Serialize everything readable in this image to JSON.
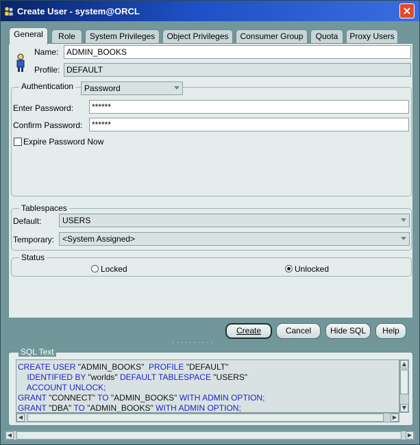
{
  "window": {
    "title": "Create User - system@ORCL",
    "close_label": "×"
  },
  "tabs": [
    {
      "label": "General"
    },
    {
      "label": "Role"
    },
    {
      "label": "System Privileges"
    },
    {
      "label": "Object Privileges"
    },
    {
      "label": "Consumer Group"
    },
    {
      "label": "Quota"
    },
    {
      "label": "Proxy Users"
    }
  ],
  "general": {
    "name_label": "Name:",
    "name_value": "ADMIN_BOOKS",
    "profile_label": "Profile:",
    "profile_value": "DEFAULT",
    "auth_label": "Authentication",
    "auth_value": "Password",
    "enter_password_label": "Enter Password:",
    "enter_password_value": "******",
    "confirm_password_label": "Confirm Password:",
    "confirm_password_value": "******",
    "expire_label": "Expire Password Now",
    "tablespaces_label": "Tablespaces",
    "default_label": "Default:",
    "default_value": "USERS",
    "temporary_label": "Temporary:",
    "temporary_value": "<System Assigned>",
    "status_label": "Status",
    "locked_label": "Locked",
    "unlocked_label": "Unlocked"
  },
  "buttons": {
    "create": "Create",
    "cancel": "Cancel",
    "hide_sql": "Hide SQL",
    "help": "Help"
  },
  "sql": {
    "label": "SQL Text",
    "lines": [
      {
        "parts": [
          [
            "kw",
            "CREATE USER "
          ],
          [
            "str",
            "\"ADMIN_BOOKS\""
          ],
          [
            "kw",
            "  PROFILE "
          ],
          [
            "str",
            "\"DEFAULT\""
          ]
        ]
      },
      {
        "parts": [
          [
            "kw",
            "    IDENTIFIED BY "
          ],
          [
            "str",
            "\"worlds\""
          ],
          [
            "kw",
            " DEFAULT TABLESPACE "
          ],
          [
            "str",
            "\"USERS\""
          ]
        ]
      },
      {
        "parts": [
          [
            "kw",
            "    ACCOUNT UNLOCK;"
          ]
        ]
      },
      {
        "parts": [
          [
            "kw",
            "GRANT "
          ],
          [
            "str",
            "\"CONNECT\""
          ],
          [
            "kw",
            " TO "
          ],
          [
            "str",
            "\"ADMIN_BOOKS\""
          ],
          [
            "kw",
            " WITH ADMIN OPTION;"
          ]
        ]
      },
      {
        "parts": [
          [
            "kw",
            "GRANT "
          ],
          [
            "str",
            "\"DBA\""
          ],
          [
            "kw",
            " TO "
          ],
          [
            "str",
            "\"ADMIN_BOOKS\""
          ],
          [
            "kw",
            " WITH ADMIN OPTION;"
          ]
        ]
      }
    ]
  },
  "icons": {
    "app": "oracle-user-icon",
    "user": "user-figure-icon"
  },
  "colors": {
    "titlebar": "#0a246a",
    "window_bg": "#71979b",
    "panel_bg": "#e4ecec",
    "sql_keyword": "#1d23c9"
  }
}
